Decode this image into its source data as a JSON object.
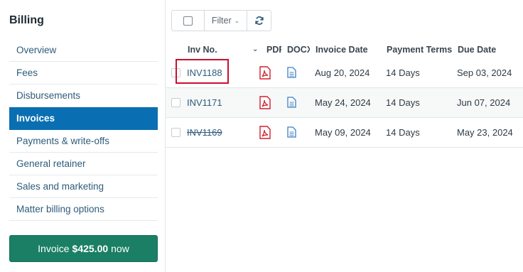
{
  "sidebar": {
    "title": "Billing",
    "items": [
      {
        "label": "Overview"
      },
      {
        "label": "Fees"
      },
      {
        "label": "Disbursements"
      },
      {
        "label": "Invoices"
      },
      {
        "label": "Payments & write-offs"
      },
      {
        "label": "General retainer"
      },
      {
        "label": "Sales and marketing"
      },
      {
        "label": "Matter billing options"
      }
    ],
    "active_item": "Invoices",
    "cta": {
      "prefix": "Invoice",
      "amount": "$425.00",
      "suffix": "now"
    }
  },
  "toolbar": {
    "filter_label": "Filter"
  },
  "table": {
    "headers": {
      "inv_no": "Inv No.",
      "pdf": "PDF",
      "docx": "DOCX",
      "invoice_date": "Invoice Date",
      "payment_terms": "Payment Terms",
      "due_date": "Due Date"
    },
    "rows": [
      {
        "inv_no": "INV1188",
        "invoice_date": "Aug 20, 2024",
        "payment_terms": "14 Days",
        "due_date": "Sep 03, 2024"
      },
      {
        "inv_no": "INV1171",
        "invoice_date": "May 24, 2024",
        "payment_terms": "14 Days",
        "due_date": "Jun 07, 2024"
      },
      {
        "inv_no": "INV1169",
        "invoice_date": "May 09, 2024",
        "payment_terms": "14 Days",
        "due_date": "May 23, 2024"
      }
    ]
  },
  "colors": {
    "active_nav": "#0a6fb2",
    "cta": "#1a7f64",
    "link": "#2d5c7a",
    "pdf_icon": "#d0202a",
    "doc_icon": "#3d7fc1",
    "highlight": "#c8102e"
  }
}
